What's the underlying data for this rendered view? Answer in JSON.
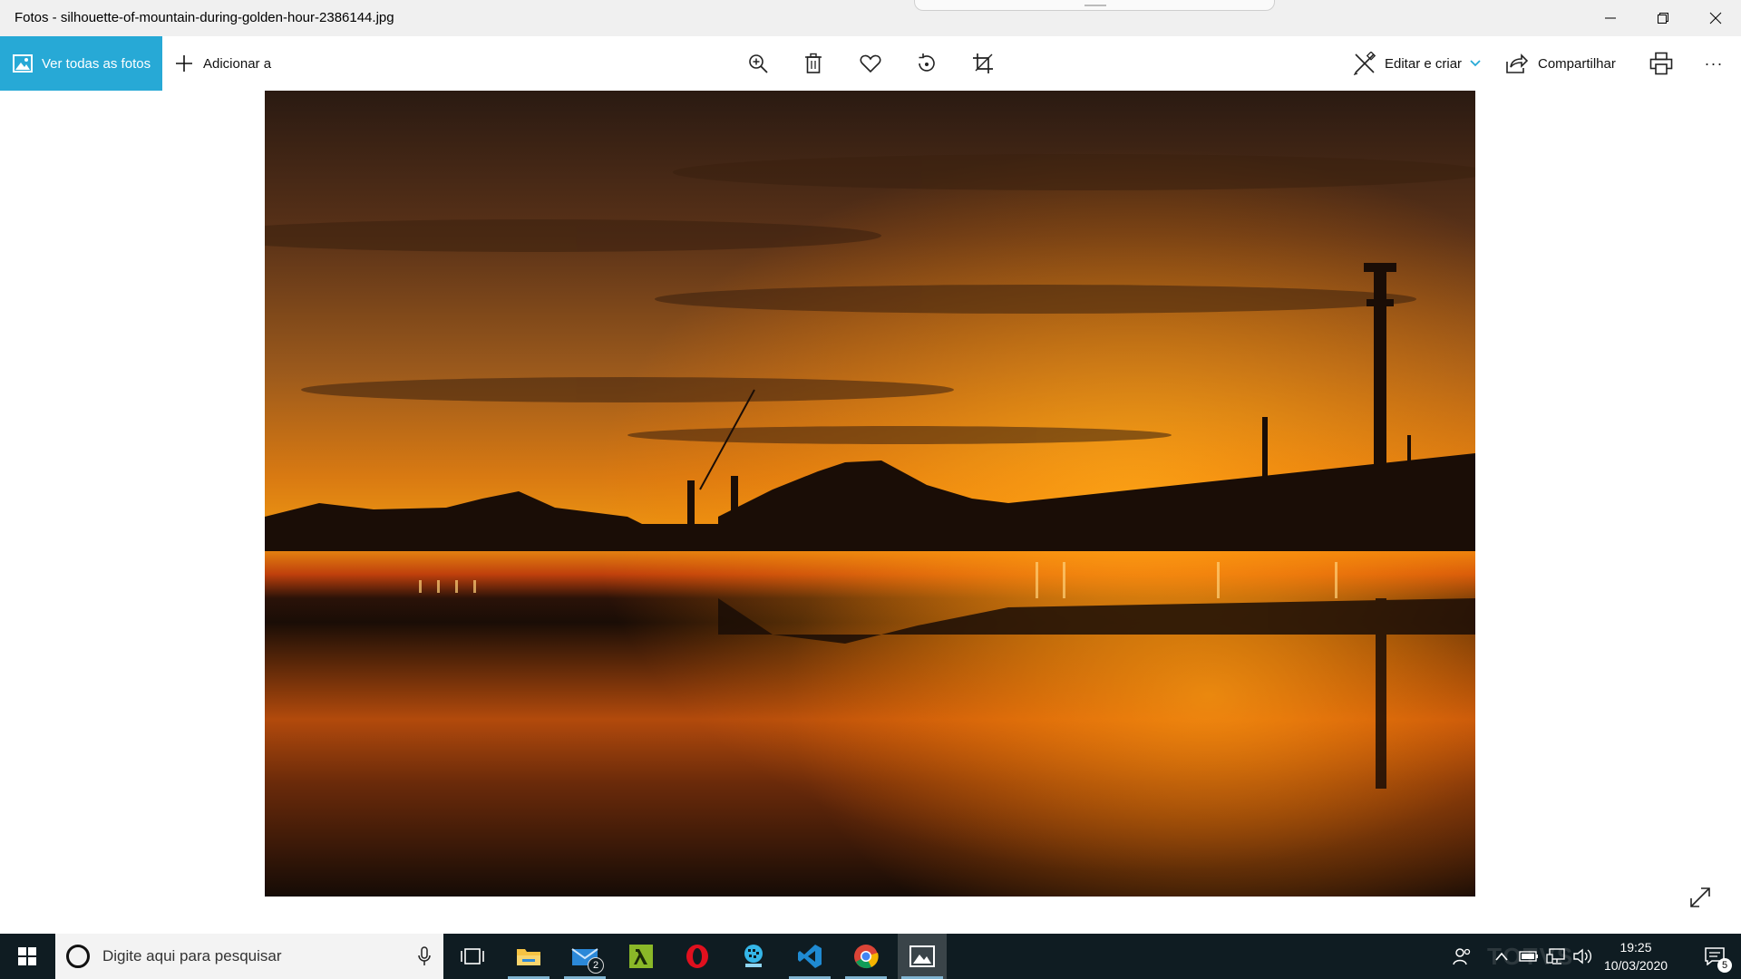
{
  "window": {
    "title": "Fotos - silhouette-of-mountain-during-golden-hour-2386144.jpg",
    "controls": [
      "minimize-icon",
      "restore-icon",
      "close-icon"
    ]
  },
  "toolbar": {
    "see_all_label": "Ver todas as fotos",
    "add_to_label": "Adicionar a",
    "tools": [
      "zoom-in-icon",
      "trash-icon",
      "heart-icon",
      "rotate-icon",
      "crop-icon"
    ],
    "edit_label": "Editar e criar",
    "share_label": "Compartilhar",
    "more_label": "···"
  },
  "colors": {
    "accent": "#27a9d6",
    "taskbar": "#0f1c22"
  },
  "photo": {
    "subject": "silhouette-of-mountain-during-golden-hour"
  },
  "taskbar": {
    "search_placeholder": "Digite aqui para pesquisar",
    "apps": [
      "task-view-icon",
      "file-explorer-icon",
      "mail-icon",
      "lambda-app-icon",
      "opera-icon",
      "qr-app-icon",
      "vscode-icon",
      "chrome-icon",
      "photos-icon"
    ],
    "mail_badge": "2",
    "time": "19:25",
    "date": "10/03/2020",
    "notification_count": "5",
    "watermark": "TOTVS"
  }
}
